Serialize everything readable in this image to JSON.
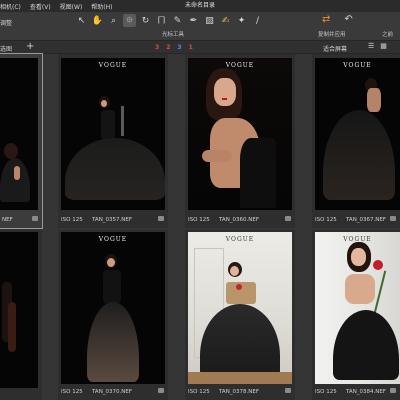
{
  "menubar": {
    "items": [
      "相机(C)",
      "查看(V)",
      "视图(W)",
      "帮助(H)"
    ],
    "window_title": "未命名目录"
  },
  "toolbar": {
    "left_text": "调整",
    "tools_label": "光标工具",
    "tools": [
      "arrow-cursor-icon",
      "pan-hand-icon",
      "zoom-icon",
      "crop-icon",
      "rotate-icon",
      "keystone-icon",
      "picker-icon",
      "brush-icon",
      "eraser-icon",
      "wb-picker-icon",
      "spot-heal-icon",
      "gradient-icon"
    ],
    "copy_apply_label": "复制并应用",
    "previous_label": "之前"
  },
  "filterbar": {
    "left_text": "选图",
    "labels": [
      {
        "text": "3",
        "color": "#e04848"
      },
      {
        "text": "2",
        "color": "#e04848"
      },
      {
        "text": "3",
        "color": "#5a84e8"
      },
      {
        "text": "1",
        "color": "#e04848"
      }
    ],
    "fit_label": "适合屏幕"
  },
  "thumbnails": [
    {
      "iso": "ISO 125",
      "filename": "NEF",
      "mark": "VOGUE",
      "bg": "dark",
      "selected": true
    },
    {
      "iso": "ISO 125",
      "filename": "TAN_0357.NEF",
      "mark": "VOGUE",
      "bg": "dark",
      "selected": false
    },
    {
      "iso": "ISO 125",
      "filename": "TAN_0360.NEF",
      "mark": "VOGUE",
      "bg": "dark",
      "selected": false
    },
    {
      "iso": "ISO 125",
      "filename": "TAN_0367.NEF",
      "mark": "VOGUE",
      "bg": "dark",
      "selected": false
    },
    {
      "iso": "ISO 125",
      "filename": "NEF",
      "mark": "",
      "bg": "dark",
      "selected": false
    },
    {
      "iso": "ISO 125",
      "filename": "TAN_0370.NEF",
      "mark": "VOGUE",
      "bg": "dark",
      "selected": false
    },
    {
      "iso": "ISO 125",
      "filename": "TAN_0378.NEF",
      "mark": "VOGUE",
      "bg": "light",
      "selected": false
    },
    {
      "iso": "ISO 125",
      "filename": "TAN_0384.NEF",
      "mark": "VOGUE",
      "bg": "wall",
      "selected": false
    }
  ]
}
